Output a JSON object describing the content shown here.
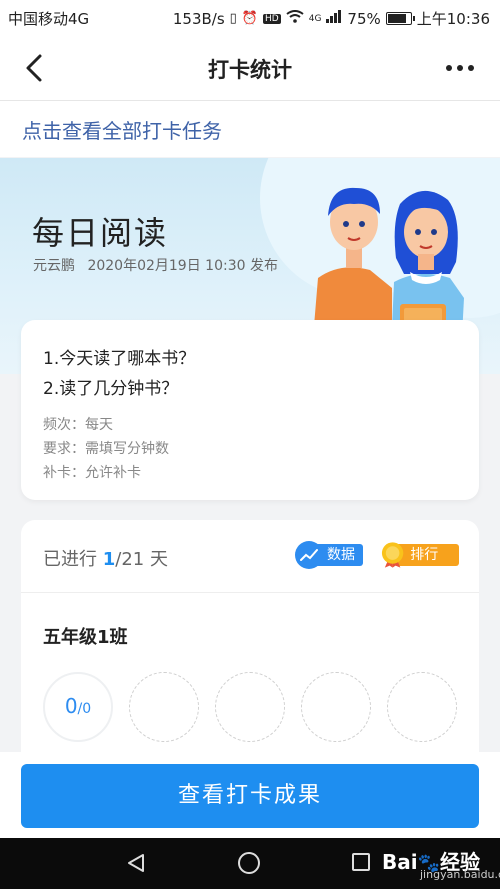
{
  "status_bar": {
    "carrier": "中国移动4G",
    "speed": "153B/s",
    "hd": "HD",
    "network": "4G",
    "battery": "75%",
    "time": "上午10:36"
  },
  "nav": {
    "title": "打卡统计"
  },
  "all_tasks_link": "点击查看全部打卡任务",
  "banner": {
    "title": "每日阅读",
    "author": "元云鹏",
    "published": "2020年02月19日 10:30 发布"
  },
  "task": {
    "questions": [
      "1.今天读了哪本书？",
      "2.读了几分钟书？"
    ],
    "frequency": "频次：每天",
    "requirement": "要求：需填写分钟数",
    "makeup": "补卡：允许补卡"
  },
  "progress": {
    "prefix": "已进行 ",
    "current_day": "1",
    "total_suffix": "/21 天",
    "stats_label": "数据",
    "rank_label": "排行榜",
    "class_name": "五年级1班",
    "checked_in": "0",
    "total_members": "/0"
  },
  "cta": "查看打卡成果",
  "watermark": {
    "brand": "Bai",
    "brand2": "经验",
    "site": "jingyan.baidu.com"
  },
  "colors": {
    "accent": "#1e8ef0",
    "link": "#3f63a8",
    "rank": "#f7a21c"
  }
}
